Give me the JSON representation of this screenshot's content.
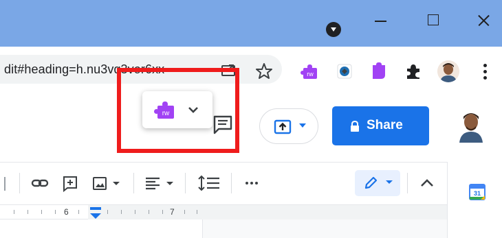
{
  "browser": {
    "address_text": "dit#heading=h.nu3vq3vor6xx"
  },
  "extension_popup": {
    "extension_badge": "rw"
  },
  "doc_header": {
    "share_label": "Share"
  },
  "ruler": {
    "labels": [
      "6",
      "7"
    ]
  },
  "icons": {
    "omnibox": [
      "share-page-icon",
      "bookmark-star-icon"
    ],
    "extensions": [
      "rw-extension-icon",
      "blue-extension-icon",
      "purple-extension-icon",
      "extensions-puzzle-icon"
    ],
    "window": [
      "minimize-icon",
      "maximize-icon",
      "close-icon"
    ],
    "format": [
      "link-icon",
      "add-comment-icon",
      "image-icon",
      "align-icon",
      "line-spacing-icon",
      "more-icon",
      "edit-pencil-icon",
      "collapse-chevron-icon"
    ],
    "side_panel": [
      "calendar-icon"
    ]
  },
  "colors": {
    "titlebar": "#7aa7e6",
    "share_button": "#1a73e8",
    "highlight_box": "#ef1c1c",
    "extension_purple": "#a142f4"
  }
}
